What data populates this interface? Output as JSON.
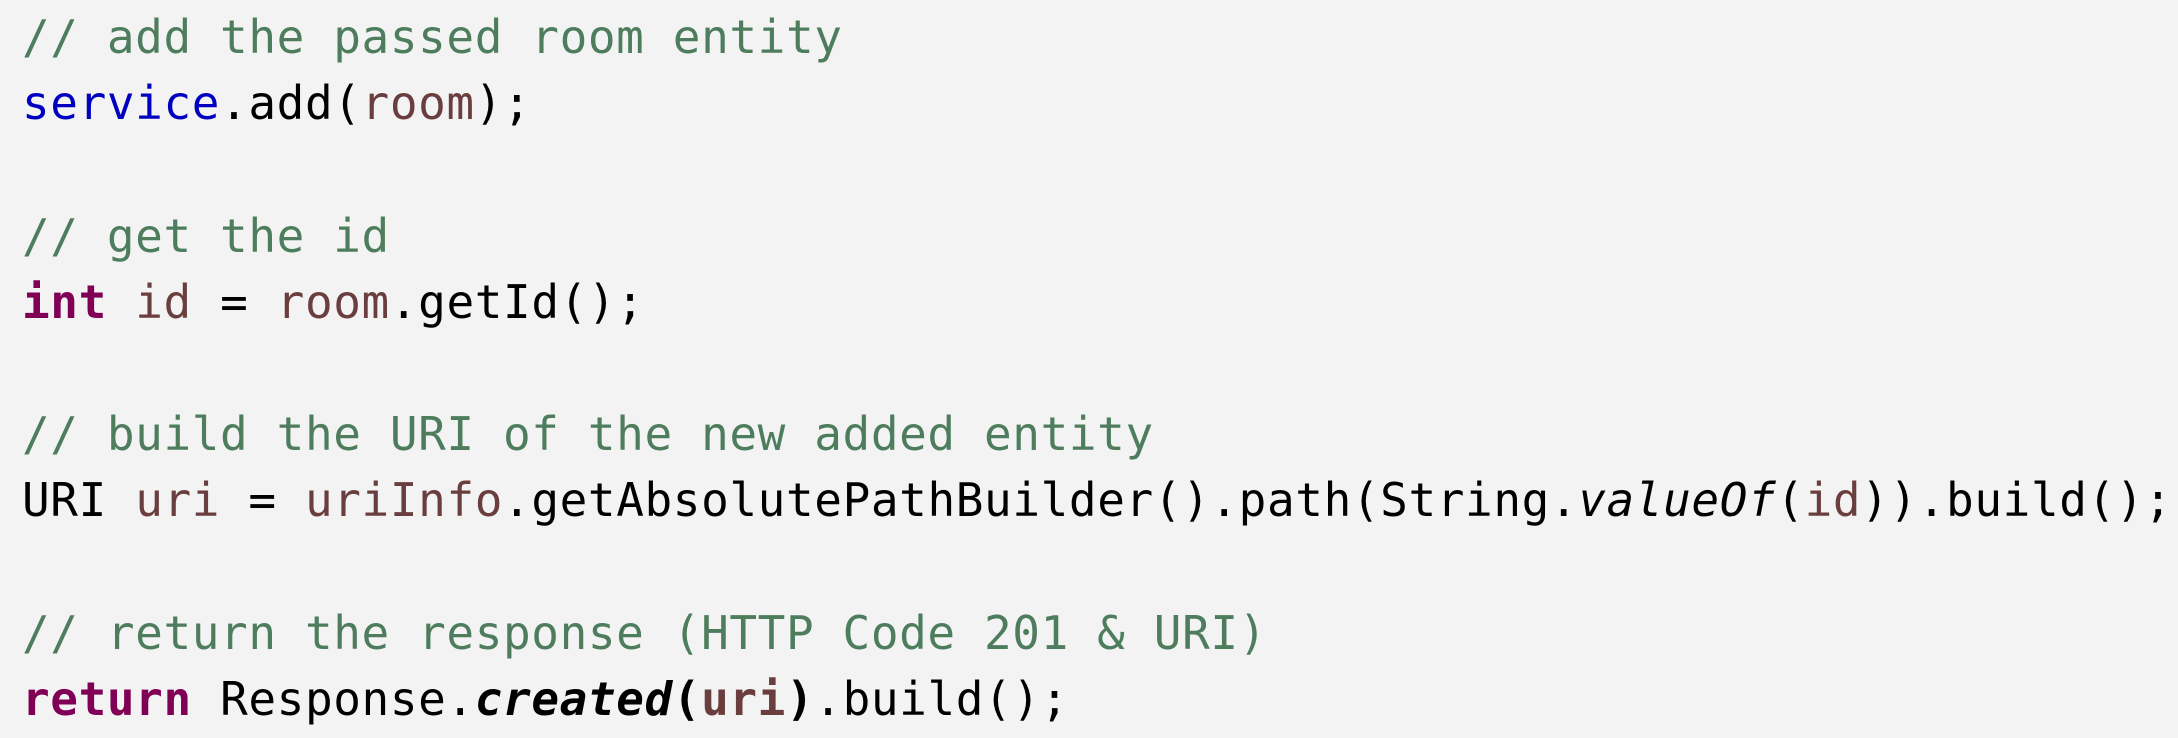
{
  "editor": {
    "background": "#f3f3f3",
    "colors": {
      "comment": "#4e7d5e",
      "field": "#0000c0",
      "variable": "#6a3e3e",
      "keyword": "#7f0055",
      "plain": "#000000"
    },
    "lines": [
      {
        "tokens": [
          {
            "text": "// add the passed room entity",
            "kind": "comment"
          }
        ]
      },
      {
        "tokens": [
          {
            "text": "service",
            "kind": "field"
          },
          {
            "text": ".add(",
            "kind": "plain"
          },
          {
            "text": "room",
            "kind": "var"
          },
          {
            "text": ");",
            "kind": "plain"
          }
        ]
      },
      {
        "tokens": []
      },
      {
        "tokens": [
          {
            "text": "// get the id",
            "kind": "comment"
          }
        ]
      },
      {
        "tokens": [
          {
            "text": "int",
            "kind": "kw"
          },
          {
            "text": " ",
            "kind": "plain"
          },
          {
            "text": "id",
            "kind": "var"
          },
          {
            "text": " = ",
            "kind": "plain"
          },
          {
            "text": "room",
            "kind": "var"
          },
          {
            "text": ".getId();",
            "kind": "plain"
          }
        ]
      },
      {
        "tokens": []
      },
      {
        "tokens": [
          {
            "text": "// build the URI of the new added entity",
            "kind": "comment"
          }
        ]
      },
      {
        "tokens": [
          {
            "text": "URI ",
            "kind": "plain"
          },
          {
            "text": "uri",
            "kind": "var"
          },
          {
            "text": " = ",
            "kind": "plain"
          },
          {
            "text": "uriInfo",
            "kind": "var"
          },
          {
            "text": ".getAbsolutePathBuilder().path(String.",
            "kind": "plain"
          },
          {
            "text": "valueOf",
            "kind": "italic"
          },
          {
            "text": "(",
            "kind": "plain"
          },
          {
            "text": "id",
            "kind": "var"
          },
          {
            "text": ")).build();",
            "kind": "plain"
          }
        ]
      },
      {
        "tokens": []
      },
      {
        "tokens": [
          {
            "text": "// return the response (HTTP Code 201 & URI)",
            "kind": "comment"
          }
        ]
      },
      {
        "tokens": [
          {
            "text": "return",
            "kind": "kw"
          },
          {
            "text": " Response.",
            "kind": "plain"
          },
          {
            "text": "created",
            "kind": "bolditalic"
          },
          {
            "text": "(",
            "kind": "bold"
          },
          {
            "text": "uri",
            "kind": "var bold"
          },
          {
            "text": ")",
            "kind": "bold"
          },
          {
            "text": ".build();",
            "kind": "plain"
          }
        ]
      }
    ]
  }
}
